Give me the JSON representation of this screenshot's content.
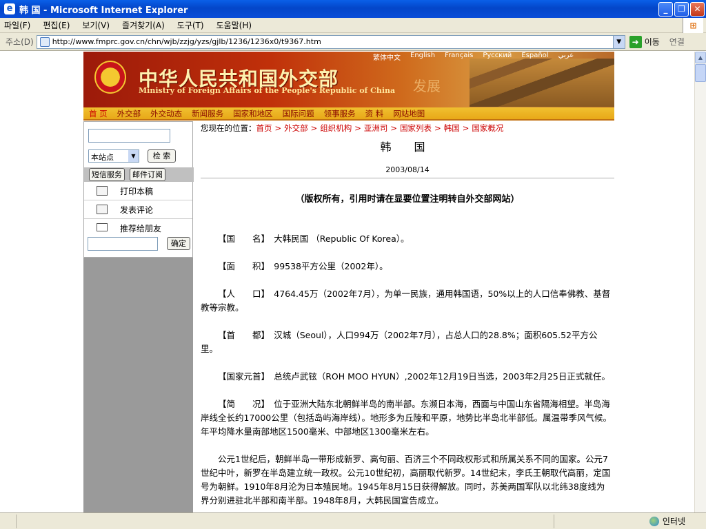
{
  "window": {
    "title": "韩   国 - Microsoft Internet Explorer"
  },
  "menu": [
    "파일(F)",
    "편집(E)",
    "보기(V)",
    "즐겨찾기(A)",
    "도구(T)",
    "도움말(H)"
  ],
  "address": {
    "label": "주소(D)",
    "url": "http://www.fmprc.gov.cn/chn/wjb/zzjg/yzs/gjlb/1236/1236x0/t9367.htm",
    "go": "이동",
    "links": "연결"
  },
  "status": {
    "zone": "인터넷"
  },
  "site": {
    "langs": [
      "繁体中文",
      "English",
      "Français",
      "Русский",
      "Español",
      "عربي"
    ],
    "title_cn": "中华人民共和国外交部",
    "title_en": "Ministry of Foreign Affairs of the People's Republic of China",
    "slogan": "发展",
    "nav": [
      "首 页",
      "外交部",
      "外交动态",
      "新闻服务",
      "国家和地区",
      "国际问题",
      "领事服务",
      "资  料",
      "网站地图"
    ]
  },
  "sidebar": {
    "scope": "本站点",
    "search_btn": "检 索",
    "sms_btn": "短信服务",
    "mail_btn": "邮件订阅",
    "print": "打印本稿",
    "comment": "发表评论",
    "recommend": "推荐给朋友",
    "ok_btn": "确定"
  },
  "article": {
    "crumb_label": "您现在的位置：",
    "crumbs": [
      "首页",
      "外交部",
      "组织机构",
      "亚洲司",
      "国家列表",
      "韩国",
      "国家概况"
    ],
    "title": "韩 国",
    "date": "2003/08/14",
    "copyright": "（版权所有，引用时请在显要位置注明转自外交部网站）",
    "paragraphs": [
      "【国　　名】　大韩民国 （Republic Of Korea）。",
      "【面　　积】　99538平方公里（2002年）。",
      "【人　　口】　4764.45万（2002年7月），为单一民族，通用韩国语，50%以上的人口信奉佛教、基督教等宗教。",
      "【首　　都】　汉城（Seoul），人口994万（2002年7月），占总人口的28.8%；面积605.52平方公里。",
      "【国家元首】　总统卢武铉（ROH MOO HYUN）,2002年12月19日当选，2003年2月25日正式就任。",
      "【简　　况】　位于亚洲大陆东北朝鲜半岛的南半部。东濒日本海，西面与中国山东省隔海相望。半岛海岸线全长约17000公里（包括岛屿海岸线）。地形多为丘陵和平原，地势比半岛北半部低。属温带季风气候。年平均降水量南部地区1500毫米、中部地区1300毫米左右。",
      "公元1世纪后，朝鲜半岛一带形成新罗、高句丽、百济三个不同政权形式和所属关系不同的国家。公元7世纪中叶，新罗在半岛建立统一政权。公元10世纪初，高丽取代新罗。14世纪末，李氏王朝取代高丽，定国号为朝鲜。1910年8月沦为日本殖民地。1945年8月15日获得解放。同时，苏美两国军队以北纬38度线为界分别进驻北半部和南半部。1948年8月，大韩民国宣告成立。"
    ]
  }
}
